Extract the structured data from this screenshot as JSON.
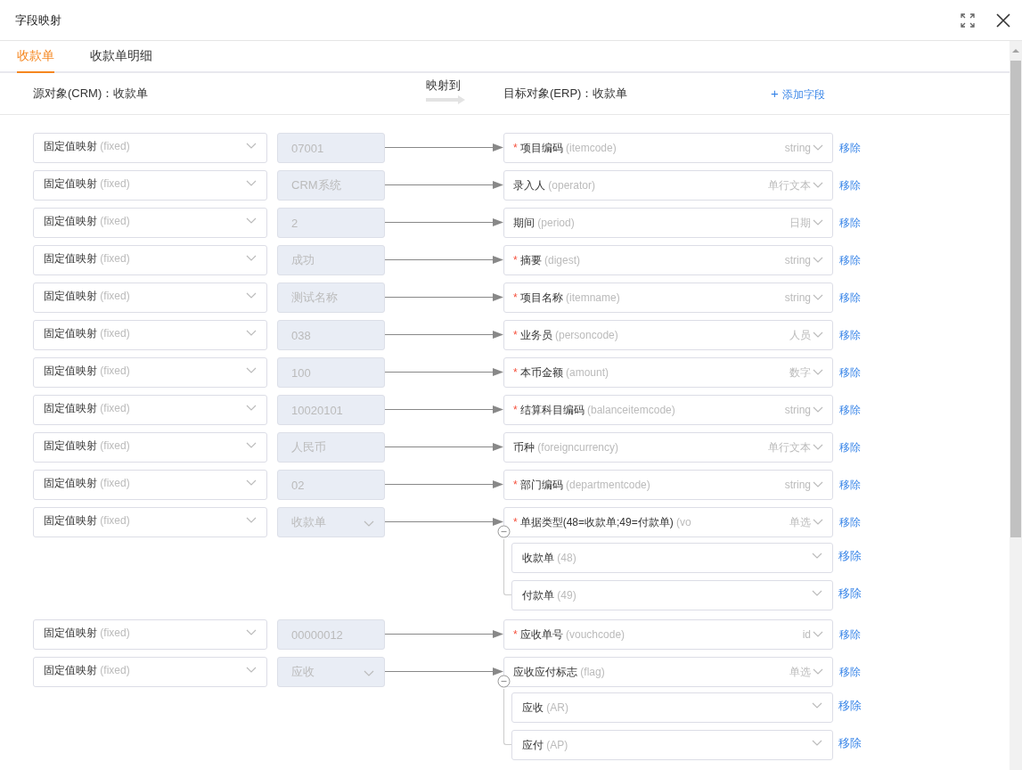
{
  "window": {
    "title": "字段映射"
  },
  "tabs": [
    {
      "label": "收款单",
      "selected": true
    },
    {
      "label": "收款单明细",
      "selected": false
    }
  ],
  "header": {
    "source": "源对象(CRM)：收款单",
    "mapping": "映射到",
    "target": "目标对象(ERP)：收款单",
    "add_field": "添加字段",
    "add_icon": "+"
  },
  "mappings": [
    {
      "source_mode": "固定值映射",
      "source_hint": "(fixed)",
      "value": "07001",
      "kind": "text",
      "required_mark": "*",
      "target_name": "项目编码",
      "target_code": "(itemcode)",
      "target_type": "string",
      "remove": "移除"
    },
    {
      "source_mode": "固定值映射",
      "source_hint": "(fixed)",
      "value": "CRM系统",
      "kind": "text",
      "target_name": "录入人",
      "target_code": "(operator)",
      "target_type": "单行文本",
      "remove": "移除"
    },
    {
      "source_mode": "固定值映射",
      "source_hint": "(fixed)",
      "value": "2",
      "kind": "text",
      "target_name": "期间",
      "target_code": "(period)",
      "target_type": "日期",
      "remove": "移除"
    },
    {
      "source_mode": "固定值映射",
      "source_hint": "(fixed)",
      "value": "成功",
      "kind": "text",
      "required_mark": "*",
      "target_name": "摘要",
      "target_code": "(digest)",
      "target_type": "string",
      "remove": "移除"
    },
    {
      "source_mode": "固定值映射",
      "source_hint": "(fixed)",
      "value": "测试名称",
      "kind": "text",
      "required_mark": "*",
      "target_name": "项目名称",
      "target_code": "(itemname)",
      "target_type": "string",
      "remove": "移除"
    },
    {
      "source_mode": "固定值映射",
      "source_hint": "(fixed)",
      "value": "038",
      "kind": "text",
      "required_mark": "*",
      "target_name": "业务员",
      "target_code": "(personcode)",
      "target_type": "人员",
      "remove": "移除"
    },
    {
      "source_mode": "固定值映射",
      "source_hint": "(fixed)",
      "value": "100",
      "kind": "text",
      "required_mark": "*",
      "target_name": "本币金额",
      "target_code": "(amount)",
      "target_type": "数字",
      "remove": "移除"
    },
    {
      "source_mode": "固定值映射",
      "source_hint": "(fixed)",
      "value": "10020101",
      "kind": "text",
      "required_mark": "*",
      "target_name": "结算科目编码",
      "target_code": "(balanceitemcode)",
      "target_type": "string",
      "remove": "移除"
    },
    {
      "source_mode": "固定值映射",
      "source_hint": "(fixed)",
      "value": "人民币",
      "kind": "text",
      "target_name": "币种",
      "target_code": "(foreigncurrency)",
      "target_type": "单行文本",
      "remove": "移除"
    },
    {
      "source_mode": "固定值映射",
      "source_hint": "(fixed)",
      "value": "02",
      "kind": "text",
      "required_mark": "*",
      "target_name": "部门编码",
      "target_code": "(departmentcode)",
      "target_type": "string",
      "remove": "移除"
    },
    {
      "source_mode": "固定值映射",
      "source_hint": "(fixed)",
      "value": "收款单",
      "kind": "select",
      "required_mark": "*",
      "target_name": "单据类型(48=收款单;49=付款单)",
      "target_code": "(vo",
      "target_type": "单选",
      "remove": "移除",
      "options": [
        {
          "name": "收款单",
          "code": "(48)",
          "remove": "移除"
        },
        {
          "name": "付款单",
          "code": "(49)",
          "remove": "移除"
        }
      ]
    },
    {
      "source_mode": "固定值映射",
      "source_hint": "(fixed)",
      "value": "00000012",
      "kind": "text",
      "required_mark": "*",
      "target_name": "应收单号",
      "target_code": "(vouchcode)",
      "target_type": "id",
      "remove": "移除"
    },
    {
      "source_mode": "固定值映射",
      "source_hint": "(fixed)",
      "value": "应收",
      "kind": "select",
      "target_name": "应收应付标志",
      "target_code": "(flag)",
      "target_type": "单选",
      "remove": "移除",
      "options": [
        {
          "name": "应收",
          "code": "(AR)",
          "remove": "移除"
        },
        {
          "name": "应付",
          "code": "(AP)",
          "remove": "移除"
        }
      ]
    }
  ]
}
